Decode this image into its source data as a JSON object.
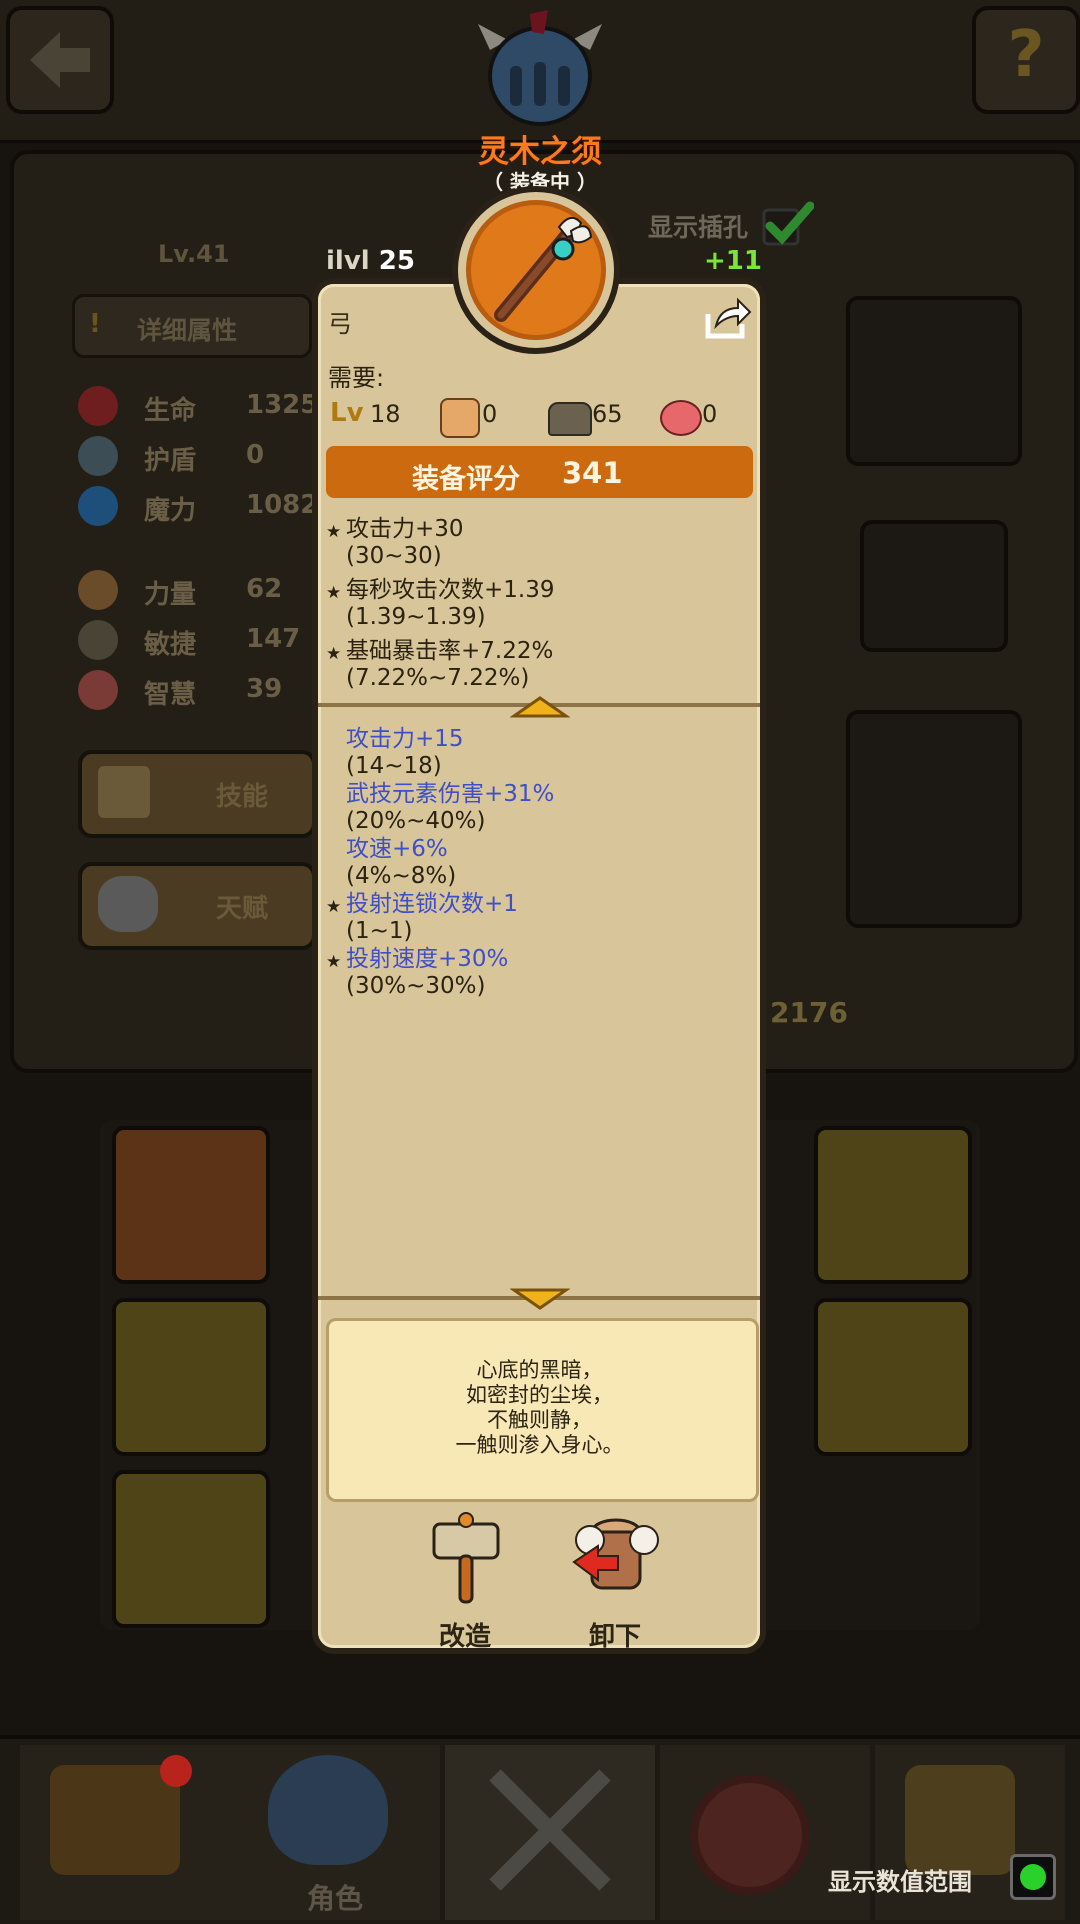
{
  "header": {
    "item_name": "灵木之须",
    "equipped_status": "（ 装备中 ）",
    "show_sockets_label": "显示插孔",
    "ilvl_prefix": "ilvl",
    "ilvl_value": "25",
    "upgrade_delta": "+11"
  },
  "background": {
    "level_label": "Lv.41",
    "detail_attr_label": "详细属性",
    "stats": [
      {
        "icon": "heart-icon",
        "label": "生命",
        "value": "1325"
      },
      {
        "icon": "shield-icon",
        "label": "护盾",
        "value": "0"
      },
      {
        "icon": "mana-drop-icon",
        "label": "魔力",
        "value": "1082"
      },
      {
        "icon": "fist-icon",
        "label": "力量",
        "value": "62"
      },
      {
        "icon": "boot-icon",
        "label": "敏捷",
        "value": "147"
      },
      {
        "icon": "brain-icon",
        "label": "智慧",
        "value": "39"
      }
    ],
    "skill_button": "技能",
    "talent_button": "天赋",
    "power_total": "2176"
  },
  "tooltip": {
    "item_type": "弓",
    "requirements_label": "需要:",
    "requirements": [
      {
        "icon": "level-icon",
        "label": "Lv",
        "value": "18"
      },
      {
        "icon": "fist-icon",
        "value": "0"
      },
      {
        "icon": "boot-icon",
        "value": "65"
      },
      {
        "icon": "brain-icon",
        "value": "0"
      }
    ],
    "score_label": "装备评分",
    "score_value": "341",
    "base_stats": [
      {
        "text": "攻击力+30",
        "range": "(30~30)"
      },
      {
        "text": "每秒攻击次数+1.39",
        "range": "(1.39~1.39)"
      },
      {
        "text": "基础暴击率+7.22%",
        "range": "(7.22%~7.22%)"
      }
    ],
    "affixes": [
      {
        "text": "攻击力+15",
        "range": "(14~18)",
        "starred": false
      },
      {
        "text": "武技元素伤害+31%",
        "range": "(20%~40%)",
        "starred": false
      },
      {
        "text": "攻速+6%",
        "range": "(4%~8%)",
        "starred": false
      },
      {
        "text": "投射连锁次数+1",
        "range": "(1~1)",
        "starred": true
      },
      {
        "text": "投射速度+30%",
        "range": "(30%~30%)",
        "starred": true
      }
    ],
    "lore": [
      "心底的黑暗，",
      "如密封的尘埃，",
      "不触则静，",
      "一触则渗入身心。"
    ],
    "actions": {
      "reforge": "改造",
      "unequip": "卸下"
    }
  },
  "bottom_nav": {
    "character_label": "角色",
    "show_range_label": "显示数值范围",
    "show_range_enabled": true
  },
  "colors": {
    "score_bar": "#cc6a10",
    "affix_blue": "#3e4fc7",
    "item_name": "#ff7a1a",
    "upgrade_green": "#7de53a"
  }
}
